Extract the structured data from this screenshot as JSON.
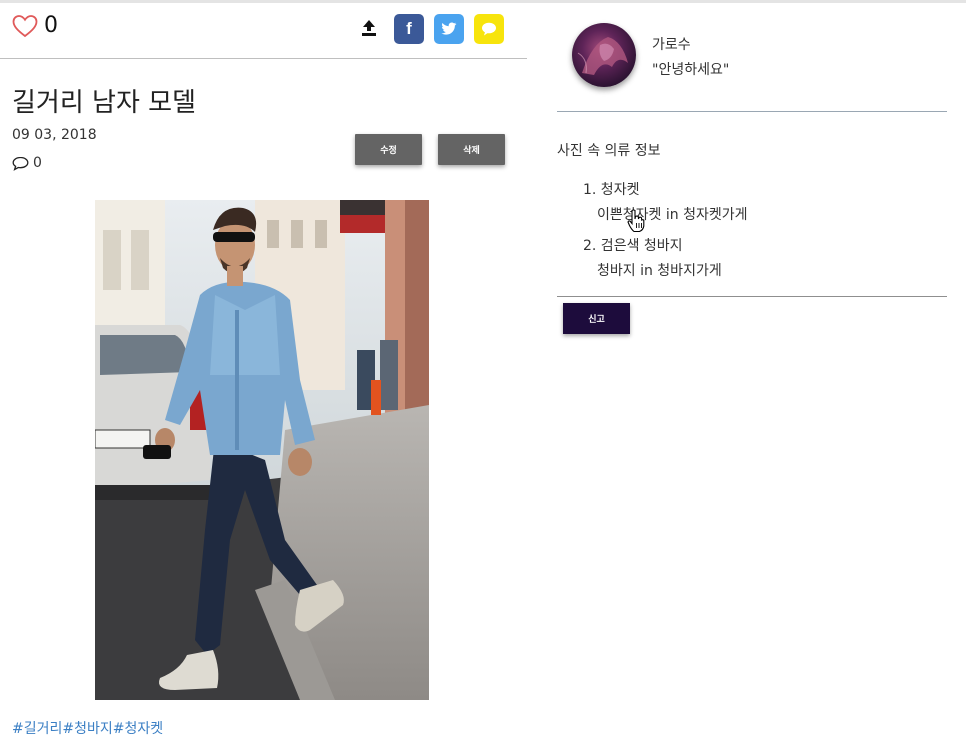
{
  "post": {
    "likes": "0",
    "title": "길거리 남자 모델",
    "date": "09 03, 2018",
    "comment_count": "0",
    "edit_label": "수정",
    "delete_label": "삭제",
    "hashtags": "#길거리#청바지#청자켓"
  },
  "share": {
    "facebook_glyph": "f",
    "colors": {
      "facebook": "#3b5998",
      "twitter": "#4aa3ef",
      "kakao": "#f7e40c"
    }
  },
  "profile": {
    "name": "가로수",
    "status": "\"안녕하세요\""
  },
  "clothing": {
    "title": "사진 속 의류 정보",
    "items": [
      {
        "name": "1. 청자켓",
        "detail": "이쁜청자켓 in 청자켓가게"
      },
      {
        "name": "2. 검은색 청바지",
        "detail": "청바지 in 청바지가게"
      }
    ],
    "report_label": "신고"
  },
  "icons": [
    "heart-icon",
    "share-upload-icon",
    "facebook-icon",
    "twitter-icon",
    "kakao-icon",
    "comment-icon",
    "hand-cursor-icon"
  ],
  "colors": {
    "report_button": "#1d0c3c",
    "action_button": "#646464",
    "heart": "#e05a5a",
    "hashtag": "#3b7fc4"
  }
}
